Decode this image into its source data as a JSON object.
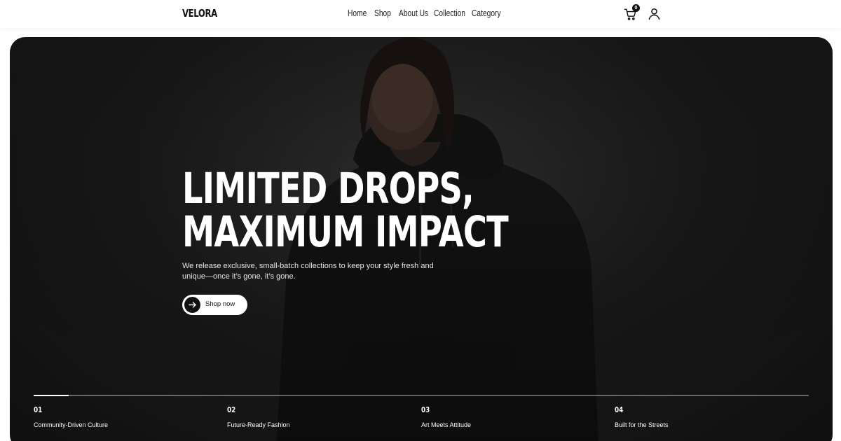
{
  "header": {
    "logo": "VELORA",
    "nav": [
      "Home",
      "Shop",
      "About Us",
      "Collection",
      "Category"
    ],
    "cart_count": "0",
    "cart_icon": "cart-icon",
    "user_icon": "user-icon"
  },
  "hero": {
    "headline_line1": "LIMITED DROPS,",
    "headline_line2": "MAXIMUM IMPACT",
    "subtext": "We release exclusive, small-batch collections to keep your style fresh and unique—once it’s gone, it’s gone.",
    "cta_label": "Shop now",
    "cta_icon": "arrow-right-icon",
    "slide_progress": 0.045
  },
  "features": [
    {
      "num": "01",
      "label": "Community-Driven Culture"
    },
    {
      "num": "02",
      "label": "Future-Ready Fashion"
    },
    {
      "num": "03",
      "label": "Art Meets Attitude"
    },
    {
      "num": "04",
      "label": "Built for the Streets"
    }
  ],
  "colors": {
    "background": "#ffffff",
    "hero_bg": "#1d1d1d",
    "text_primary": "#111111",
    "hero_text": "#ffffff"
  }
}
